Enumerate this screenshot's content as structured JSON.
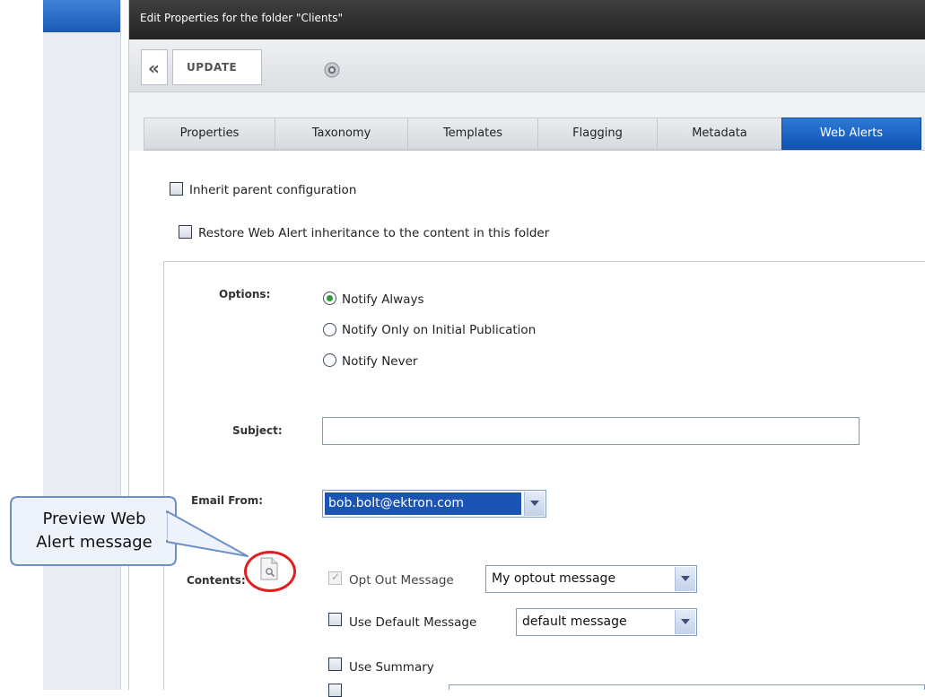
{
  "window": {
    "title": "Edit Properties for the folder \"Clients\""
  },
  "toolbar": {
    "back_label": "«",
    "update_label": "UPDATE",
    "help_icon": "help-icon"
  },
  "tabs": [
    {
      "label": "Properties",
      "active": false
    },
    {
      "label": "Taxonomy",
      "active": false
    },
    {
      "label": "Templates",
      "active": false
    },
    {
      "label": "Flagging",
      "active": false
    },
    {
      "label": "Metadata",
      "active": false
    },
    {
      "label": "Web Alerts",
      "active": true
    }
  ],
  "inheritance": {
    "inherit_label": "Inherit parent configuration",
    "inherit_checked": false,
    "restore_label": "Restore Web Alert inheritance to the content in this folder",
    "restore_checked": false
  },
  "form": {
    "options_label": "Options:",
    "options": [
      {
        "label": "Notify Always",
        "selected": true
      },
      {
        "label": "Notify Only on Initial Publication",
        "selected": false
      },
      {
        "label": "Notify Never",
        "selected": false
      }
    ],
    "subject_label": "Subject:",
    "subject_value": "",
    "email_from_label": "Email From:",
    "email_from_value": "bob.bolt@ektron.com",
    "contents_label": "Contents:",
    "opt_out_label": "Opt Out Message",
    "opt_out_checked": true,
    "opt_out_disabled": true,
    "opt_out_select": "My optout message",
    "use_default_label": "Use Default Message",
    "use_default_checked": false,
    "use_default_select": "default message",
    "use_summary_label": "Use Summary",
    "use_summary_checked": false
  },
  "callout": {
    "line1": "Preview Web",
    "line2": "Alert message"
  },
  "colors": {
    "title_bar": "#2c2c2c",
    "active_tab": "#1a5fc0",
    "highlight_circle": "#e02020",
    "selected_option": "#1b54b3"
  }
}
